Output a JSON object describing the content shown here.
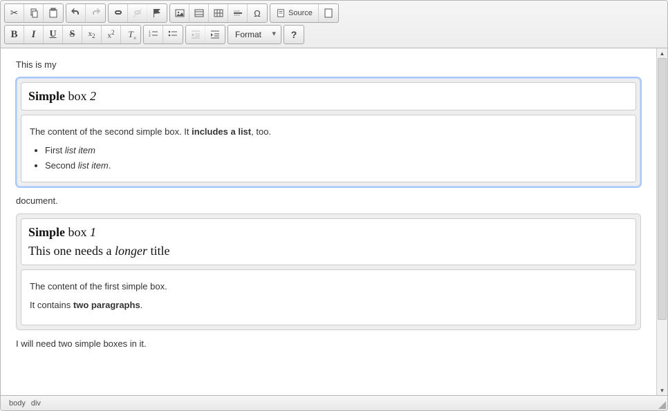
{
  "toolbar": {
    "source_label": "Source",
    "format_label": "Format",
    "help_glyph": "?"
  },
  "content": {
    "p1": "This is my",
    "box2": {
      "title_html": "<strong>Simple</strong> box <em>2</em>",
      "body_html": "<p>The content of the second simple box. It <strong>includes a list</strong>, too.</p><ul><li>First <em>list item</em></li><li>Second <em>list item</em>.</li></ul>"
    },
    "p2": "document.",
    "box1": {
      "title_html": "<strong>Simple</strong> box <em>1</em><br>This one needs a <em>longer</em> title",
      "body_html": "<p>The content of the first simple box.</p><p>It contains <strong>two paragraphs</strong>.</p>"
    },
    "p3": "I will need two simple boxes in it."
  },
  "status": {
    "path": [
      "body",
      "div"
    ]
  }
}
